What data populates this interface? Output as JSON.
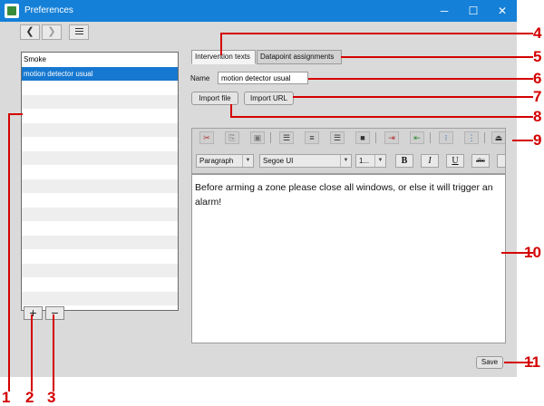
{
  "window": {
    "title": "Preferences",
    "minimize_glyph": "─",
    "maximize_glyph": "☐",
    "close_glyph": "✕"
  },
  "nav": {
    "back_glyph": "❮",
    "forward_glyph": "❯",
    "menu_icon": "hamburger-menu-icon"
  },
  "list": {
    "items": [
      {
        "label": "Smoke",
        "selected": false
      },
      {
        "label": "motion detector usual",
        "selected": true
      }
    ],
    "add_glyph": "+",
    "remove_glyph": "−"
  },
  "tabs": [
    {
      "label": "Intervention texts",
      "active": true
    },
    {
      "label": "Datapoint assignments",
      "active": false
    }
  ],
  "form": {
    "name_label": "Name",
    "name_value": "motion detector usual",
    "import_file_label": "Import file",
    "import_url_label": "Import URL"
  },
  "toolbar": {
    "cut_glyph": "✂",
    "copy_glyph": "⎘",
    "paste_glyph": "▣",
    "align_left_glyph": "☰",
    "align_center_glyph": "≡",
    "align_right_glyph": "☰",
    "justify_glyph": "■",
    "indent_glyph": "⇥",
    "outdent_glyph": "⇤",
    "bullets_glyph": "⁝",
    "numbering_glyph": "⋮",
    "eject_glyph": "⏏",
    "paragraph_style": "Paragraph",
    "font_family": "Segoe UI",
    "font_size": "1...",
    "bold_label": "B",
    "italic_label": "I",
    "underline_label": "U",
    "strike_label": "abc",
    "dropdown_glyph": "▼"
  },
  "editor": {
    "content": "Before arming a zone please close all windows, or else it will trigger an alarm!"
  },
  "save_label": "Save",
  "callout_color": "#d40000",
  "callouts": [
    "1",
    "2",
    "3",
    "4",
    "5",
    "6",
    "7",
    "8",
    "9",
    "10",
    "11"
  ]
}
